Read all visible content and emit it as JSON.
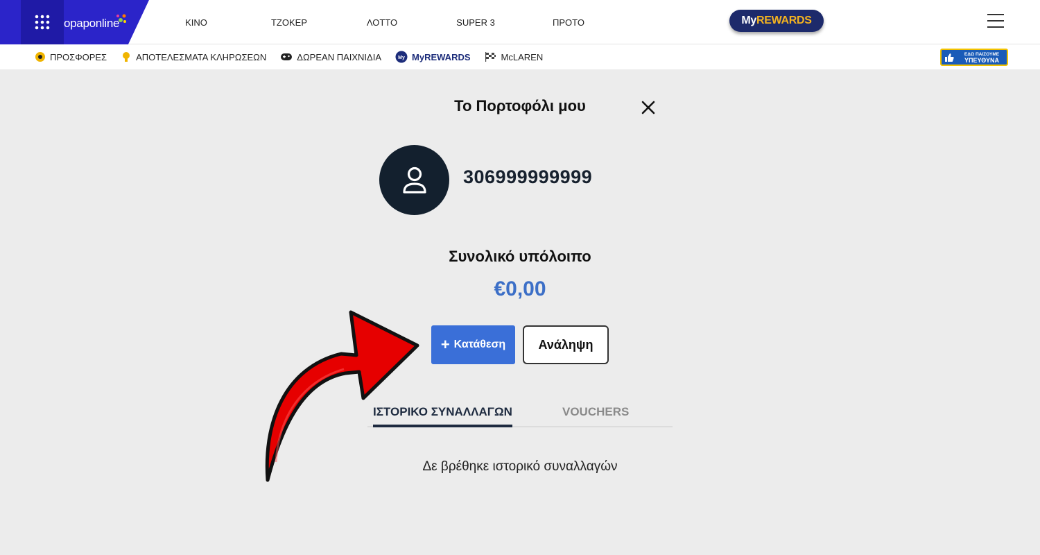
{
  "brand": {
    "logo_prefix": "opap",
    "logo_suffix": "online"
  },
  "top_nav": {
    "items": [
      {
        "label": "ΚΙΝΟ"
      },
      {
        "label": "ΤΖΟΚΕΡ"
      },
      {
        "label": "ΛΟΤΤΟ"
      },
      {
        "label": "SUPER 3"
      },
      {
        "label": "ΠΡΟΤΟ"
      }
    ],
    "rewards_my": "My",
    "rewards_rest": "REWARDS"
  },
  "sub_nav": {
    "items": [
      {
        "label": "ΠΡΟΣΦΟΡΕΣ",
        "icon": "offers-icon"
      },
      {
        "label": "ΑΠΟΤΕΛΕΣΜΑΤΑ ΚΛΗΡΩΣΕΩΝ",
        "icon": "trophy-icon"
      },
      {
        "label": "ΔΩΡΕΑΝ ΠΑΙΧΝΙΔΙΑ",
        "icon": "gamepad-icon"
      },
      {
        "label": "MyREWARDS",
        "icon": "myrewards-icon"
      },
      {
        "label": "McLAREN",
        "icon": "racing-flag-icon"
      }
    ],
    "responsible_small": "ΕΔΩ ΠΑΙΖΟΥΜΕ",
    "responsible_big": "ΥΠΕΥΘΥΝΑ"
  },
  "wallet": {
    "title": "Το Πορτοφόλι μου",
    "phone": "306999999999",
    "balance_label": "Συνολικό υπόλοιπο",
    "balance_value": "€0,00",
    "deposit_label": "Κατάθεση",
    "withdraw_label": "Ανάληψη",
    "tabs": [
      {
        "label": "ΙΣΤΟΡΙΚΟ ΣΥΝΑΛΛΑΓΩΝ",
        "active": true
      },
      {
        "label": "VOUCHERS",
        "active": false
      }
    ],
    "empty_message": "Δε βρέθηκε ιστορικό συναλλαγών"
  },
  "colors": {
    "brand_blue": "#2b24c9",
    "deposit_blue": "#3a6fd8",
    "balance_blue": "#3c6fc7",
    "dark_navy": "#13202e",
    "rewards_gold": "#f4b320",
    "arrow_red": "#e60000"
  }
}
